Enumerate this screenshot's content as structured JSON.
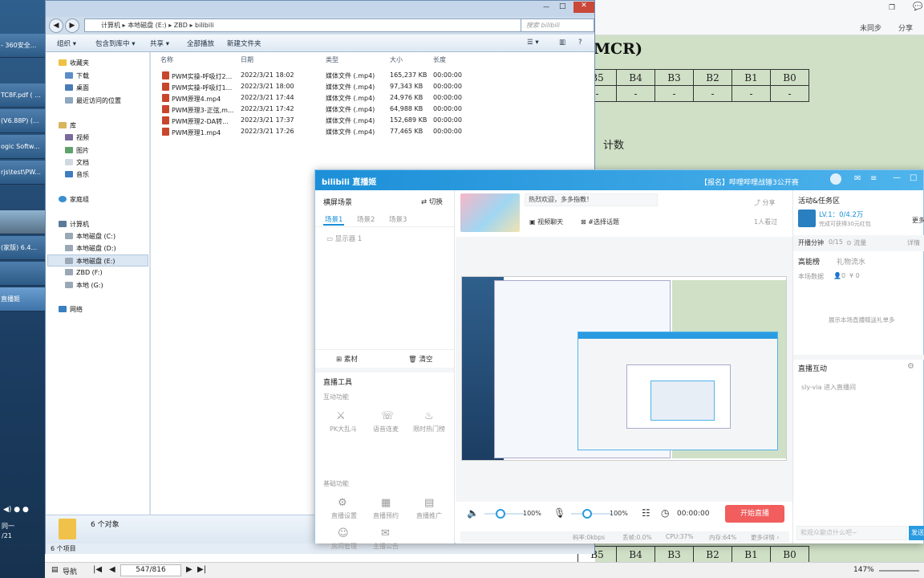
{
  "taskbar": {
    "items": [
      "- 360安全...",
      "TC8F.pdf ( ...",
      "(V6.88P) (...",
      "ogic Softw...",
      "rjs\\test\\PW...",
      "",
      "(家版) 6.4...",
      "",
      "直播姬"
    ],
    "clock": [
      "同一",
      "/21"
    ]
  },
  "document": {
    "heading": "MCR)",
    "row1_headers": [
      "B5",
      "B4",
      "B3",
      "B2",
      "B1",
      "B0"
    ],
    "row1_values": [
      "-",
      "-",
      "-",
      "-",
      "-",
      "-"
    ],
    "body_text": "计数",
    "bottom_headers": [
      "B5",
      "B4",
      "B3",
      "B2",
      "B1",
      "B0"
    ],
    "sync_label": "未同步",
    "share_label": "分享"
  },
  "explorer": {
    "breadcrumb": [
      "计算机",
      "本地磁盘 (E:)",
      "ZBD",
      "bilibili"
    ],
    "search_placeholder": "搜索 bilibili",
    "toolbar": [
      "组织 ▾",
      "包含到库中 ▾",
      "共享 ▾",
      "全部播放",
      "新建文件夹"
    ],
    "nav": {
      "favorites": "收藏夹",
      "fav_items": [
        "下载",
        "桌面",
        "最近访问的位置"
      ],
      "libraries": "库",
      "lib_items": [
        "视频",
        "图片",
        "文档",
        "音乐"
      ],
      "homegroup": "家庭组",
      "computer": "计算机",
      "drives": [
        "本地磁盘 (C:)",
        "本地磁盘 (D:)",
        "本地磁盘 (E:)",
        "ZBD (F:)",
        "本地 (G:)"
      ],
      "network": "网络"
    },
    "columns": [
      "名称",
      "日期",
      "类型",
      "大小",
      "长度"
    ],
    "files": [
      {
        "name": "PWM实操-呼吸灯2...",
        "date": "2022/3/21 18:02",
        "type": "媒体文件 (.mp4)",
        "size": "165,237 KB",
        "length": "00:00:00"
      },
      {
        "name": "PWM实操-呼吸灯1...",
        "date": "2022/3/21 18:00",
        "type": "媒体文件 (.mp4)",
        "size": "97,343 KB",
        "length": "00:00:00"
      },
      {
        "name": "PWM原理4.mp4",
        "date": "2022/3/21 17:44",
        "type": "媒体文件 (.mp4)",
        "size": "24,976 KB",
        "length": "00:00:00"
      },
      {
        "name": "PWM原理3-正弦,m...",
        "date": "2022/3/21 17:42",
        "type": "媒体文件 (.mp4)",
        "size": "64,988 KB",
        "length": "00:00:00"
      },
      {
        "name": "PWM原理2-DA转...",
        "date": "2022/3/21 17:37",
        "type": "媒体文件 (.mp4)",
        "size": "152,689 KB",
        "length": "00:00:00"
      },
      {
        "name": "PWM原理1.mp4",
        "date": "2022/3/21 17:26",
        "type": "媒体文件 (.mp4)",
        "size": "77,465 KB",
        "length": "00:00:00"
      }
    ],
    "status_count": "6 个对象",
    "bottom_count": "6 个项目"
  },
  "reader": {
    "nav_label": "导航",
    "page": "547/816",
    "zoom": "147%"
  },
  "bili": {
    "logo": "bilibili 直播姬",
    "notice": "【报名】哔哩哔哩战锤3公开赛",
    "left": {
      "scene_title": "横屏场景",
      "switch_label": "切换",
      "scenes": [
        "场景1",
        "场景2",
        "场景3"
      ],
      "source": "显示器 1",
      "material_label": "素材",
      "clear_label": "清空",
      "tools_title": "直播工具",
      "interactive_title": "互动功能",
      "interactive": [
        "PK大乱斗",
        "语音连麦",
        "限时热门榜"
      ],
      "basic_title": "基础功能",
      "basic": [
        "直播设置",
        "直播预约",
        "直播推广",
        "房间管理",
        "主播公告"
      ]
    },
    "mid": {
      "welcome": "热烈欢迎，多多指教！",
      "category": "视频聊天",
      "topic": "#选择话题",
      "share": "分享",
      "viewers": "1人看过",
      "volume1": "100%",
      "volume2": "100%",
      "timer": "00:00:00",
      "start_label": "开始直播",
      "status": [
        "码率:0kbps",
        "丢帧:0.0%",
        "CPU:37%",
        "内存:64%",
        "更多详情 ›"
      ]
    },
    "right": {
      "activity_title": "活动&任务区",
      "level": "LV.1：0/4.2万",
      "level_sub": "完成可获得30元红包",
      "more": "更多",
      "share_task": "开播分钟",
      "share_progress": "0/15",
      "flow": "流量",
      "detail": "详情",
      "rank_tabs": [
        "高能榜",
        "礼物流水"
      ],
      "data_label": "本场数据",
      "data_values": [
        "0",
        "¥ 0"
      ],
      "rank_empty": "展示本场直播赠送礼单多",
      "interact_title": "直播互动",
      "interact_msg": "sly-via 进入直播间",
      "input_placeholder": "和观众聊点什么吧~",
      "send_label": "发送"
    }
  }
}
